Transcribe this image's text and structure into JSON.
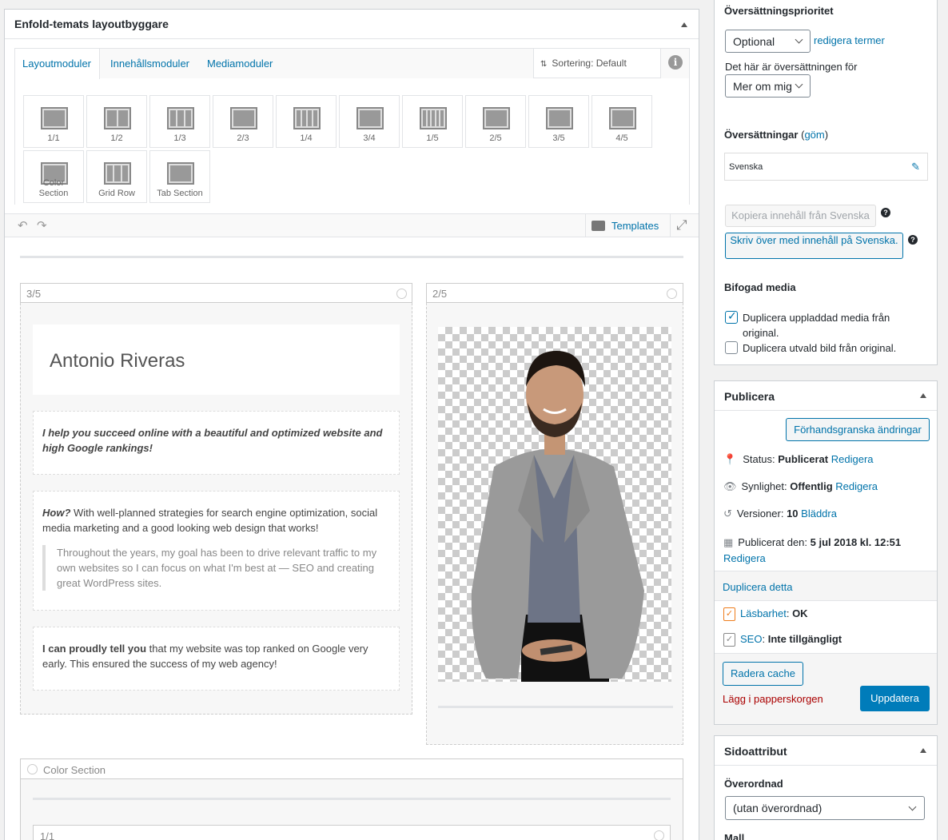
{
  "builder": {
    "title": "Enfold-temats layoutbyggare",
    "tabs": [
      "Layoutmoduler",
      "Innehållsmoduler",
      "Mediamoduler"
    ],
    "sort_label": "Sortering: Default",
    "info_icon": "i",
    "tiles": [
      "1/1",
      "1/2",
      "1/3",
      "2/3",
      "1/4",
      "3/4",
      "1/5",
      "2/5",
      "3/5",
      "4/5",
      "Color Section",
      "Grid Row",
      "Tab Section"
    ],
    "templates_label": "Templates",
    "undo_icon": "↶",
    "redo_icon": "↷",
    "expand_icon": "⤢"
  },
  "canvas": {
    "col_left_label": "3/5",
    "col_right_label": "2/5",
    "heading": "Antonio Riveras",
    "tagline": "I help you succeed online with a beautiful and optimized website and high Google rankings!",
    "how_bold": "How?",
    "how_text": " With well-planned strategies for search engine optimization, social media marketing and a good looking web design that works!",
    "quote": "Throughout the years, my goal has been to drive relevant traffic to my own websites so I can focus on what I'm best at — SEO and creating great WordPress sites.",
    "proud_bold": "I can proudly tell you",
    "proud_text": " that my website was top ranked on Google very early. This ensured the success of my web agency!",
    "color_section_label": "Color Section",
    "bottom_col_label": "1/1"
  },
  "translation": {
    "priority_title": "Översättningsprioritet",
    "priority_value": "Optional",
    "edit_terms": "redigera termer",
    "is_translation_of": "Det här är översättningen för",
    "translation_of_value": "Mer om mig",
    "translations_title": "Översättningar",
    "hide_open": " (",
    "hide_link": "göm",
    "hide_close": ")",
    "lang_value": "Svenska",
    "copy_btn": "Kopiera innehåll från Svenska",
    "overwrite_btn": "Skriv över med innehåll på Svenska.",
    "help_mark": "?",
    "media_title": "Bifogad media",
    "dup_media": "Duplicera uppladdad media från original.",
    "dup_media_checked": true,
    "dup_featured": "Duplicera utvald bild från original.",
    "dup_featured_checked": false
  },
  "publish": {
    "title": "Publicera",
    "preview_btn": "Förhandsgranska ändringar",
    "status_label": "Status: ",
    "status_value": "Publicerat",
    "status_link": "Redigera",
    "visibility_label": "Synlighet: ",
    "visibility_value": "Offentlig",
    "visibility_link": "Redigera",
    "revisions_label": "Versioner: ",
    "revisions_value": "10",
    "revisions_link": "Bläddra",
    "published_label": "Publicerat den: ",
    "published_value": "5 jul 2018 kl. 12:51",
    "published_link": "Redigera",
    "duplicate_link": "Duplicera detta",
    "readability_link": "Läsbarhet",
    "readability_sep": ": ",
    "readability_value": "OK",
    "seo_link": "SEO",
    "seo_sep": ": ",
    "seo_value": "Inte tillgängligt",
    "clear_cache_btn": "Radera cache",
    "trash_link": "Lägg i papperskorgen",
    "update_btn": "Uppdatera"
  },
  "page_attributes": {
    "title": "Sidoattribut",
    "parent_label": "Överordnad",
    "parent_value": "(utan överordnad)",
    "template_label": "Mall"
  },
  "colors": {
    "accent": "#0073aa",
    "update_button": "#007cba",
    "trash": "#a00",
    "readability_icon": "#ee7c1b"
  }
}
